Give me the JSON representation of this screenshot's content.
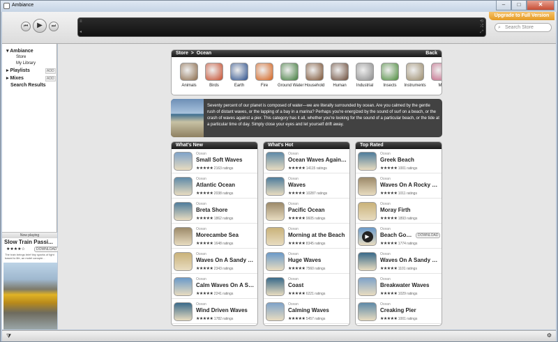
{
  "window": {
    "title": "Ambiance",
    "min": "–",
    "max": "□",
    "close": "✕"
  },
  "toolbar": {
    "upgrade": "Upgrade to Full Version",
    "search_placeholder": "Search Store"
  },
  "sidebar": {
    "ambiance": "Ambiance",
    "store": "Store",
    "library": "My Library",
    "playlists": "Playlists",
    "mixes": "Mixes",
    "add": "ADD",
    "search_results": "Search Results"
  },
  "now_playing": {
    "header": "Now playing",
    "title": "Slow Train Passi...",
    "stars": "★★★★☆",
    "download": "DOWNLOAD",
    "desc": "The train beings brief tiny sparks of light based to life, an motel canopie..."
  },
  "store": {
    "crumb_store": "Store",
    "crumb_sep": ">",
    "crumb_ocean": "Ocean",
    "back": "Back"
  },
  "categories": [
    "Animals",
    "Birds",
    "Earth",
    "Fire",
    "Ground Water",
    "Household",
    "Human",
    "Industrial",
    "Insects",
    "Instruments",
    "M"
  ],
  "intro": "Seventy percent of our planet is composed of water—we are literally surrounded by ocean. Are you calmed by the gentle rush of distant waves, or the lapping of a bay in a marina? Perhaps you're energized by the sound of surf on a beach, or the crash of waves against a pier. This category has it all, whether you're looking for the sound of a particular beach, or the tide at a particular time of day. Simply close your eyes and let yourself drift away.",
  "columns": [
    {
      "title": "What's New",
      "items": [
        {
          "cat": "Ocean",
          "name": "Small Soft Waves",
          "stars": "★★★★★",
          "ratings": "2163 ratings"
        },
        {
          "cat": "Ocean",
          "name": "Atlantic Ocean",
          "stars": "★★★★★",
          "ratings": "2038 ratings"
        },
        {
          "cat": "Ocean",
          "name": "Breta Shore",
          "stars": "★★★★★",
          "ratings": "1862 ratings"
        },
        {
          "cat": "Ocean",
          "name": "Morecambe Sea",
          "stars": "★★★★★",
          "ratings": "1648 ratings"
        },
        {
          "cat": "Ocean",
          "name": "Waves On A Sandy B...",
          "stars": "★★★★★",
          "ratings": "2343 ratings"
        },
        {
          "cat": "Ocean",
          "name": "Calm Waves On A Sa...",
          "stars": "★★★★★",
          "ratings": "2241 ratings"
        },
        {
          "cat": "Ocean",
          "name": "Wind Driven Waves",
          "stars": "★★★★★",
          "ratings": "1782 ratings"
        }
      ]
    },
    {
      "title": "What's Hot",
      "items": [
        {
          "cat": "Ocean",
          "name": "Ocean Waves Against...",
          "stars": "★★★★★",
          "ratings": "14115 ratings"
        },
        {
          "cat": "Ocean",
          "name": "Waves",
          "stars": "★★★★★",
          "ratings": "10287 ratings"
        },
        {
          "cat": "Ocean",
          "name": "Pacific Ocean",
          "stars": "★★★★★",
          "ratings": "9605 ratings"
        },
        {
          "cat": "Ocean",
          "name": "Morning at the Beach",
          "stars": "★★★★★",
          "ratings": "8345 ratings"
        },
        {
          "cat": "Ocean",
          "name": "Huge Waves",
          "stars": "★★★★★",
          "ratings": "7560 ratings"
        },
        {
          "cat": "Ocean",
          "name": "Coast",
          "stars": "★★★★★",
          "ratings": "6221 ratings"
        },
        {
          "cat": "Ocean",
          "name": "Calming Waves",
          "stars": "★★★★★",
          "ratings": "5457 ratings"
        }
      ]
    },
    {
      "title": "Top Rated",
      "items": [
        {
          "cat": "Ocean",
          "name": "Greek Beach",
          "stars": "★★★★★",
          "ratings": "1001 ratings"
        },
        {
          "cat": "Ocean",
          "name": "Waves On A Rocky B...",
          "stars": "★★★★★",
          "ratings": "1011 ratings"
        },
        {
          "cat": "Ocean",
          "name": "Moray Firth",
          "stars": "★★★★★",
          "ratings": "1893 ratings"
        },
        {
          "cat": "Ocean",
          "name": "Beach Goer...",
          "stars": "★★★★★",
          "ratings": "1774 ratings",
          "download": "DOWNLOAD"
        },
        {
          "cat": "Ocean",
          "name": "Waves On A Sandy B...",
          "stars": "★★★★★",
          "ratings": "1101 ratings"
        },
        {
          "cat": "Ocean",
          "name": "Breakwater Waves",
          "stars": "★★★★★",
          "ratings": "1029 ratings"
        },
        {
          "cat": "Ocean",
          "name": "Creaking Pier",
          "stars": "★★★★★",
          "ratings": "1001 ratings"
        }
      ]
    }
  ],
  "colors": {
    "accent": "#e49a23",
    "header": "#1a1a1a"
  }
}
